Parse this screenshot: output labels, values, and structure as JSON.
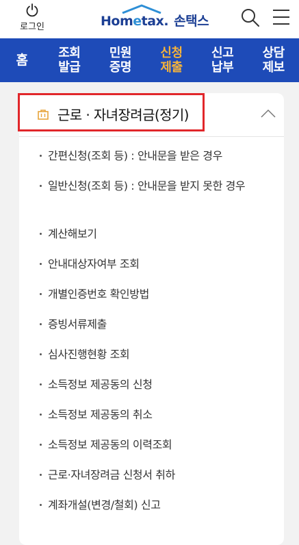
{
  "header": {
    "login_label": "로그인",
    "logo": {
      "brand_part1": "Hom",
      "brand_part2": "e",
      "brand_part3": "tax.",
      "brand_korean": "손택스"
    },
    "icons": [
      "power-icon",
      "search-icon",
      "hamburger-menu-icon"
    ],
    "colors": {
      "brand": "#1c3f94",
      "accent": "#2e8fd6"
    }
  },
  "nav": {
    "items": [
      {
        "label": "홈",
        "active": false
      },
      {
        "label": "조회\n발급",
        "active": false
      },
      {
        "label": "민원\n증명",
        "active": false
      },
      {
        "label": "신청\n제출",
        "active": true
      },
      {
        "label": "신고\n납부",
        "active": false
      },
      {
        "label": "상담\n제보",
        "active": false
      }
    ],
    "colors": {
      "background": "#1e4bb8",
      "text": "#ffffff",
      "active_text": "#f6b33a"
    }
  },
  "section": {
    "title": "근로 · 자녀장려금(정기)",
    "icon": "shopping-bag-icon",
    "expanded": true,
    "highlight_color": "#e1262a",
    "items": [
      "간편신청(조회 등) : 안내문을 받은 경우",
      "일반신청(조회 등) : 안내문을 받지 못한 경우",
      "계산해보기",
      "안내대상자여부 조회",
      "개별인증번호 확인방법",
      "증빙서류제출",
      "심사진행현황 조회",
      "소득정보 제공동의 신청",
      "소득정보 제공동의 취소",
      "소득정보 제공동의 이력조회",
      "근로·자녀장려금 신청서 취하",
      "계좌개설(변경/철회) 신고"
    ]
  }
}
